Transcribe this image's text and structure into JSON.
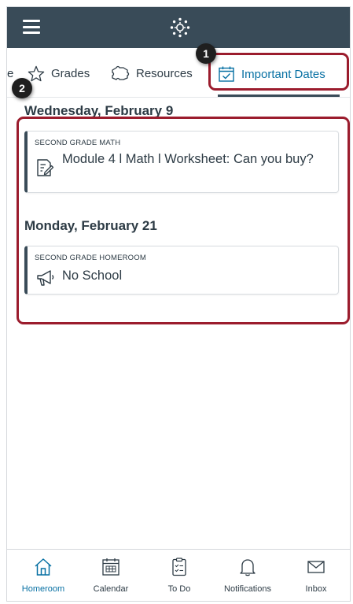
{
  "tabs": {
    "partial_label": "e",
    "grades_label": "Grades",
    "resources_label": "Resources",
    "dates_label": "Important Dates"
  },
  "callouts": {
    "one": "1",
    "two": "2"
  },
  "groups": [
    {
      "date": "Wednesday, February 9",
      "course": "SECOND GRADE MATH",
      "title": "Module 4 l Math l  Worksheet: Can you buy?",
      "icon": "assignment-icon"
    },
    {
      "date": "Monday, February 21",
      "course": "SECOND GRADE HOMEROOM",
      "title": "No School",
      "icon": "announcement-icon"
    }
  ],
  "bottom_nav": [
    {
      "label": "Homeroom",
      "icon": "home-icon",
      "active": true
    },
    {
      "label": "Calendar",
      "icon": "calendar-icon"
    },
    {
      "label": "To Do",
      "icon": "todo-icon"
    },
    {
      "label": "Notifications",
      "icon": "bell-icon"
    },
    {
      "label": "Inbox",
      "icon": "mail-icon"
    }
  ],
  "colors": {
    "header": "#394b58",
    "accent": "#0770a3",
    "callout": "#9b1c2d"
  }
}
